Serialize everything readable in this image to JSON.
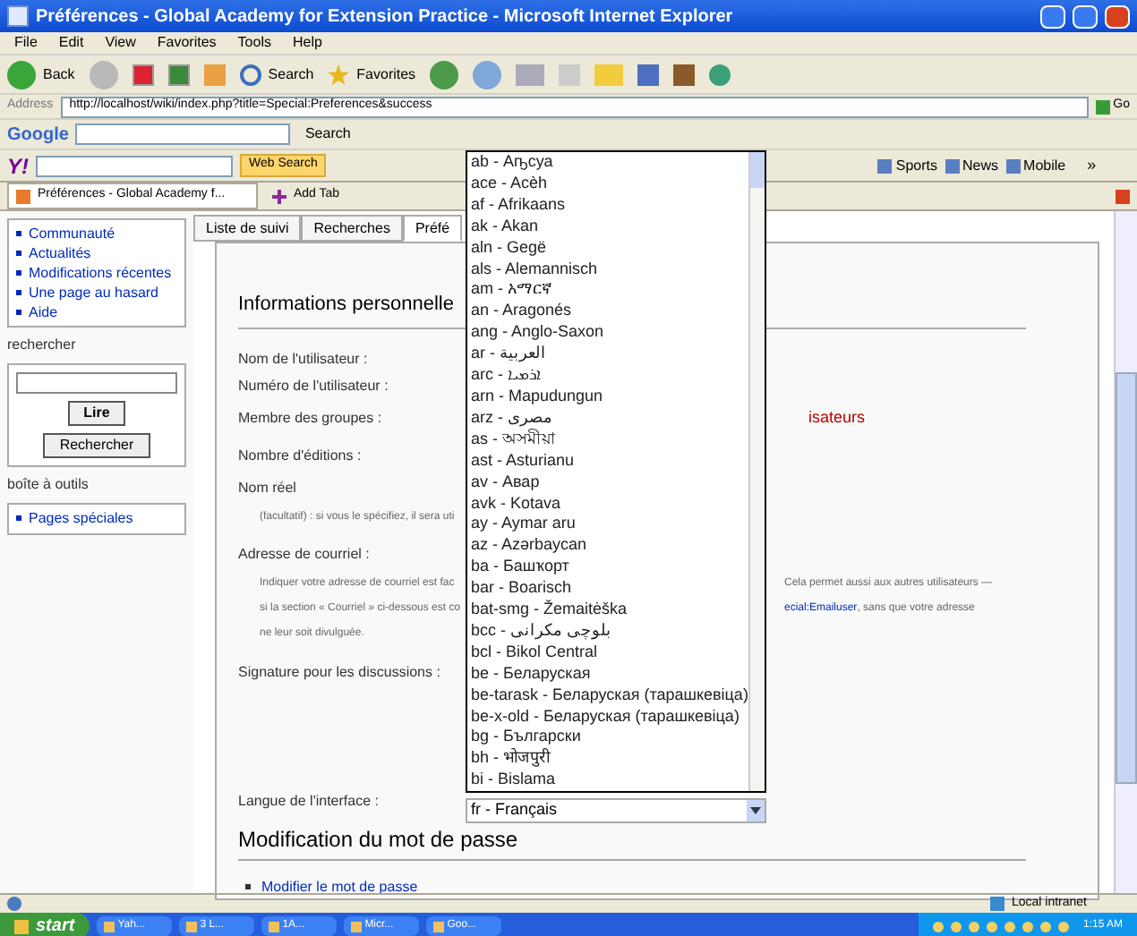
{
  "window": {
    "title": "Préférences - Global Academy for Extension Practice - Microsoft Internet Explorer"
  },
  "menu": [
    "File",
    "Edit",
    "View",
    "Favorites",
    "Tools",
    "Help"
  ],
  "toolbar": {
    "back": "Back",
    "search": "Search",
    "favorites": "Favorites"
  },
  "address": {
    "label": "Address",
    "value": "http://localhost/wiki/index.php?title=Special:Preferences&success",
    "go": "Go"
  },
  "google_bar": {
    "logo": "Google",
    "search": "Search"
  },
  "yahoo_bar": {
    "logo": "Y!",
    "web_search": "Web Search",
    "links": [
      "Sports",
      "News",
      "Mobile"
    ],
    "more": "»"
  },
  "browser_tabs": [
    {
      "label": "Préférences - Global Academy f...",
      "selected": true
    }
  ],
  "add_tab": "Add Tab",
  "sidebar": {
    "nav": [
      "Communauté",
      "Actualités",
      "Modifications récentes",
      "Une page au hasard",
      "Aide"
    ],
    "search_heading": "rechercher",
    "go_button": "Lire",
    "search_button": "Rechercher",
    "tools_heading": "boîte à outils",
    "tools": [
      "Pages spéciales"
    ]
  },
  "page_tabs": [
    {
      "label": "Liste de suivi",
      "selected": false
    },
    {
      "label": "Recherches",
      "selected": false
    },
    {
      "label": "Préfé",
      "selected": true
    }
  ],
  "section1": "Informations personnelle",
  "fields": [
    {
      "label": "Nom de l'utilisateur :"
    },
    {
      "label": "Numéro de l'utilisateur :"
    },
    {
      "label": "Membre des groupes :",
      "value": "isateurs"
    },
    {
      "label": "Nombre d'éditions :"
    },
    {
      "label": "Nom réel"
    }
  ],
  "real_name_help": "(facultatif) : si vous le spécifiez, il sera uti",
  "email_label": "Adresse de courriel :",
  "email_help": [
    {
      "left": "Indiquer votre adresse de courriel est fac",
      "right": "Cela permet aussi aux autres utilisateurs —"
    },
    {
      "left": "si la section « Courriel » ci-dessous est co",
      "right_link": "ecial:Emailuser",
      "right": ", sans que votre adresse"
    },
    {
      "left": "ne leur soit divulguée."
    }
  ],
  "signature_label": "Signature pour les discussions :",
  "language_label": "Langue de l'interface :",
  "language_select": {
    "value": "fr - Français",
    "expanded": true,
    "options": [
      "ab - Аҧсуа",
      "ace - Acèh",
      "af - Afrikaans",
      "ak - Akan",
      "aln - Gegë",
      "als - Alemannisch",
      "am - አማርኛ",
      "an - Aragonés",
      "ang - Anglo-Saxon",
      "ar - العربية",
      "arc - ܐܪܡܝܐ",
      "arn - Mapudungun",
      "arz - مصرى",
      "as - অসমীয়া",
      "ast - Asturianu",
      "av - Авар",
      "avk - Kotava",
      "ay - Aymar aru",
      "az - Azərbaycan",
      "ba - Башҡорт",
      "bar - Boarisch",
      "bat-smg - Žemaitėška",
      "bcc - بلوچی مکرانی",
      "bcl - Bikol Central",
      "be - Беларуская",
      "be-tarask - Беларуская (тарашкевіца)",
      "be-x-old - Беларуская (тарашкевіца)",
      "bg - Български",
      "bh - भोजपुरी",
      "bi - Bislama"
    ]
  },
  "section2": "Modification du mot de passe",
  "password_link": "Modifier le mot de passe",
  "status_bar": {
    "zone": "Local intranet"
  },
  "taskbar": {
    "start": "start",
    "items": [
      "Yah...",
      "3 L...",
      "1A...",
      "Micr...",
      "Goo..."
    ],
    "clock": "1:15 AM"
  }
}
